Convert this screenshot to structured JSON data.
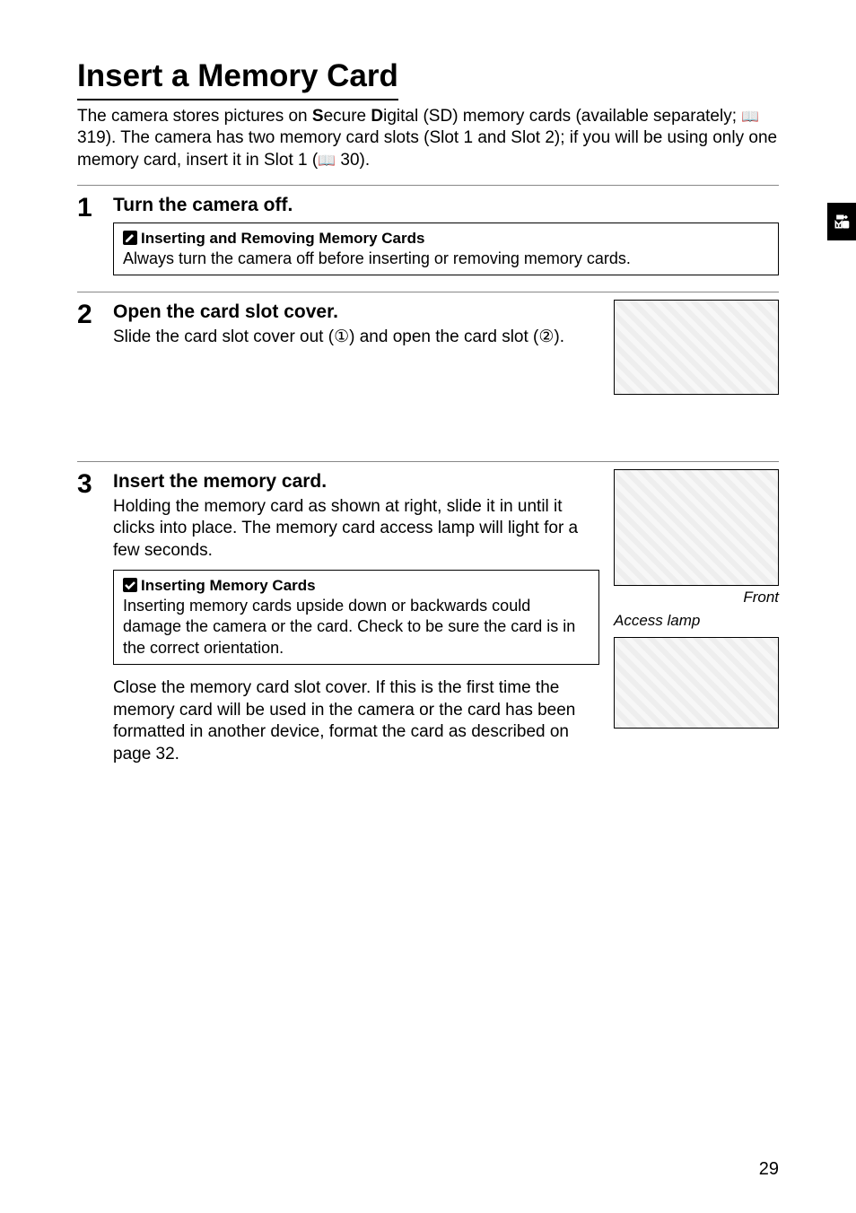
{
  "title": "Insert a Memory Card",
  "intro_pre": "The camera stores pictures on ",
  "intro_s": "S",
  "intro_mid1": "ecure ",
  "intro_d": "D",
  "intro_mid2": "igital (SD) memory cards (available separately; ",
  "intro_ref1": " 319).  The camera has two memory card slots (Slot 1 and Slot 2); if you will be using only one memory card, insert it in Slot 1 (",
  "intro_ref2": " 30).",
  "book_glyph": "📖",
  "steps": {
    "s1": {
      "num": "1",
      "title": "Turn the camera off.",
      "callout_title": "Inserting and Removing Memory Cards",
      "callout_body": "Always turn the camera off before inserting or removing memory cards."
    },
    "s2": {
      "num": "2",
      "title": "Open the card slot cover.",
      "body_pre": "Slide the card slot cover out (",
      "c1": "①",
      "body_mid": ") and open the card slot (",
      "c2": "②",
      "body_post": ")."
    },
    "s3": {
      "num": "3",
      "title": "Insert the memory card.",
      "body1": "Holding the memory card as shown at right, slide it in until it clicks into place.  The memory card access lamp will light for a few seconds.",
      "callout_title": "Inserting Memory Cards",
      "callout_body": "Inserting memory cards upside down or backwards could damage the camera or the card.  Check to be sure the card is in the correct orientation.",
      "body2": "Close the memory card slot cover.  If this is the first time the memory card will be used in the camera or the card has been formatted in another device, format the card as described on page 32.",
      "caption_front": "Front",
      "caption_access": "Access lamp"
    }
  },
  "page_number": "29"
}
